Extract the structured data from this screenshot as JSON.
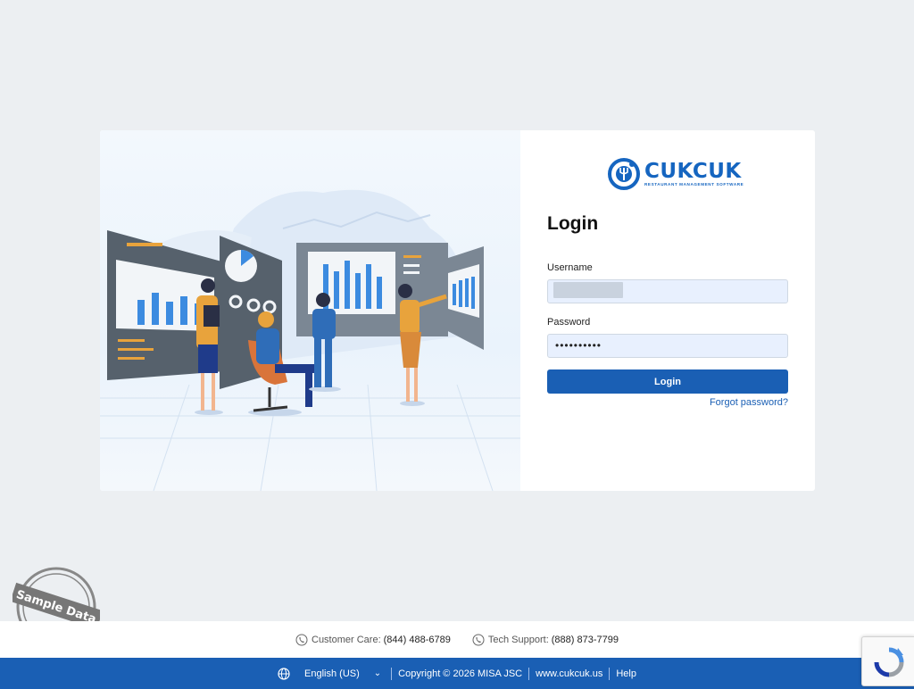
{
  "brand": {
    "name": "CUKCUK",
    "tagline": "RESTAURANT MANAGEMENT SOFTWARE",
    "color": "#1565c0"
  },
  "login": {
    "title": "Login",
    "username_label": "Username",
    "username_value": "",
    "password_label": "Password",
    "password_value": "••••••••••",
    "submit_label": "Login",
    "forgot_label": "Forgot password?"
  },
  "contact": {
    "customer_care_label": "Customer Care:",
    "customer_care_number": "(844) 488-6789",
    "tech_support_label": "Tech Support:",
    "tech_support_number": "(888) 873-7799"
  },
  "footer": {
    "language": "English (US)",
    "copyright": "Copyright © 2026 MISA JSC",
    "website": "www.cukcuk.us",
    "help": "Help"
  },
  "stamp": {
    "text": "Sample Data"
  },
  "colors": {
    "primary": "#1a5fb4",
    "page_bg": "#eceff2",
    "input_bg": "#e8f0fe"
  }
}
